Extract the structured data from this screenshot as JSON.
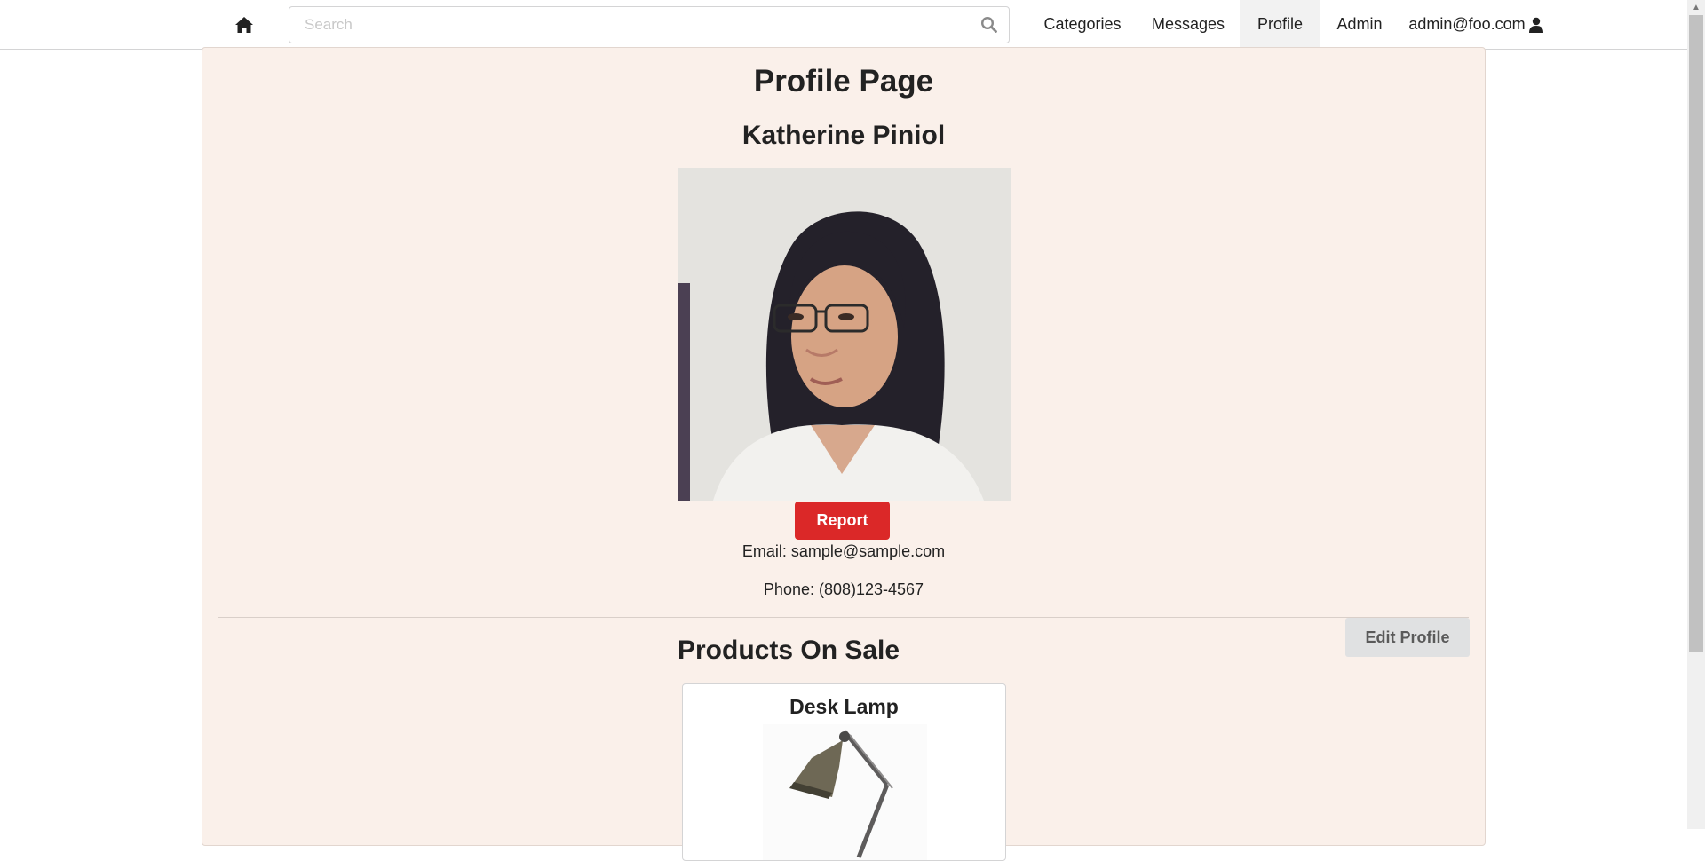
{
  "nav": {
    "home_icon": "home-icon",
    "search_placeholder": "Search",
    "search_icon": "search-icon",
    "items": [
      {
        "label": "Categories"
      },
      {
        "label": "Messages"
      },
      {
        "label": "Profile",
        "active": true
      },
      {
        "label": "Admin"
      }
    ],
    "user_label": "admin@foo.com",
    "user_icon": "user-icon"
  },
  "profile": {
    "page_title": "Profile Page",
    "name": "Katherine Piniol",
    "report_label": "Report",
    "email": "Email: sample@sample.com",
    "phone": "Phone: (808)123-4567",
    "edit_label": "Edit Profile"
  },
  "products": {
    "section_title": "Products On Sale",
    "items": [
      {
        "name": "Desk Lamp"
      }
    ]
  },
  "colors": {
    "page_background": "#faf0ea",
    "report_button": "#db2828",
    "edit_button": "#e0e1e2",
    "active_nav": "#f2f2f2"
  }
}
